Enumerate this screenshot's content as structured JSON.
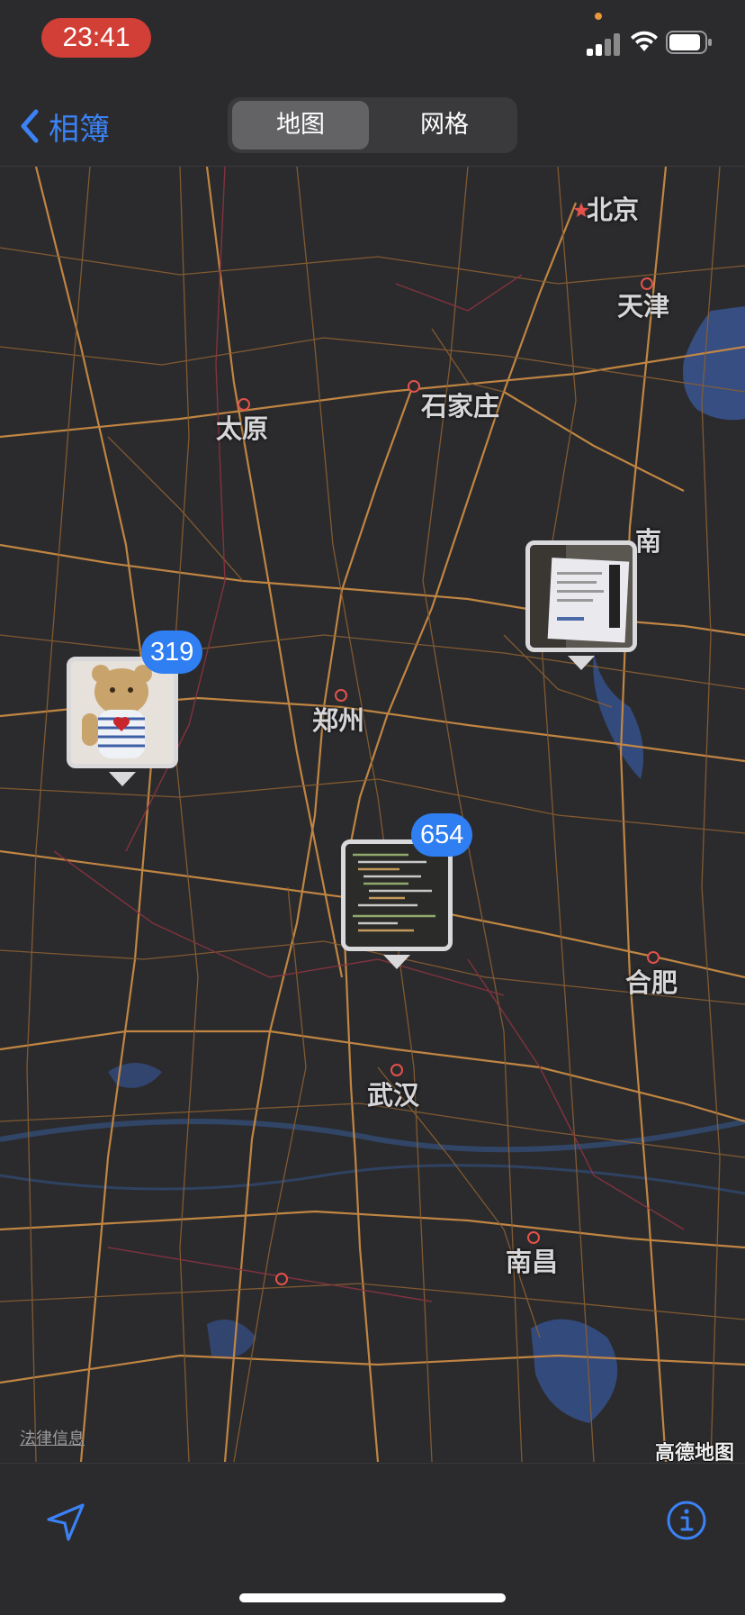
{
  "status_bar": {
    "time": "23:41"
  },
  "nav": {
    "back_label": "相簿",
    "segments": {
      "map": "地图",
      "grid": "网格"
    }
  },
  "map": {
    "cities": {
      "beijing": "北京",
      "tianjin": "天津",
      "shijiazhuang": "石家庄",
      "taiyuan": "太原",
      "jinan_partial": "南",
      "zhengzhou": "郑州",
      "hefei": "合肥",
      "wuhan": "武汉",
      "nanchang": "南昌"
    },
    "legal_link": "法律信息",
    "attribution": "高德地图",
    "pins": [
      {
        "count": "319",
        "thumb": "teddy-bear-photo"
      },
      {
        "count": "654",
        "thumb": "code-screen-photo"
      },
      {
        "count": "",
        "thumb": "receipt-photo"
      }
    ]
  },
  "toolbar": {
    "location_icon": "location-arrow-icon",
    "info_icon": "info-circle-icon"
  },
  "colors": {
    "accent": "#3a82f6",
    "badge": "#2f7ef2",
    "roads": "#c98a44",
    "city_dot": "#e3524b",
    "time_pill": "#d23f36"
  }
}
